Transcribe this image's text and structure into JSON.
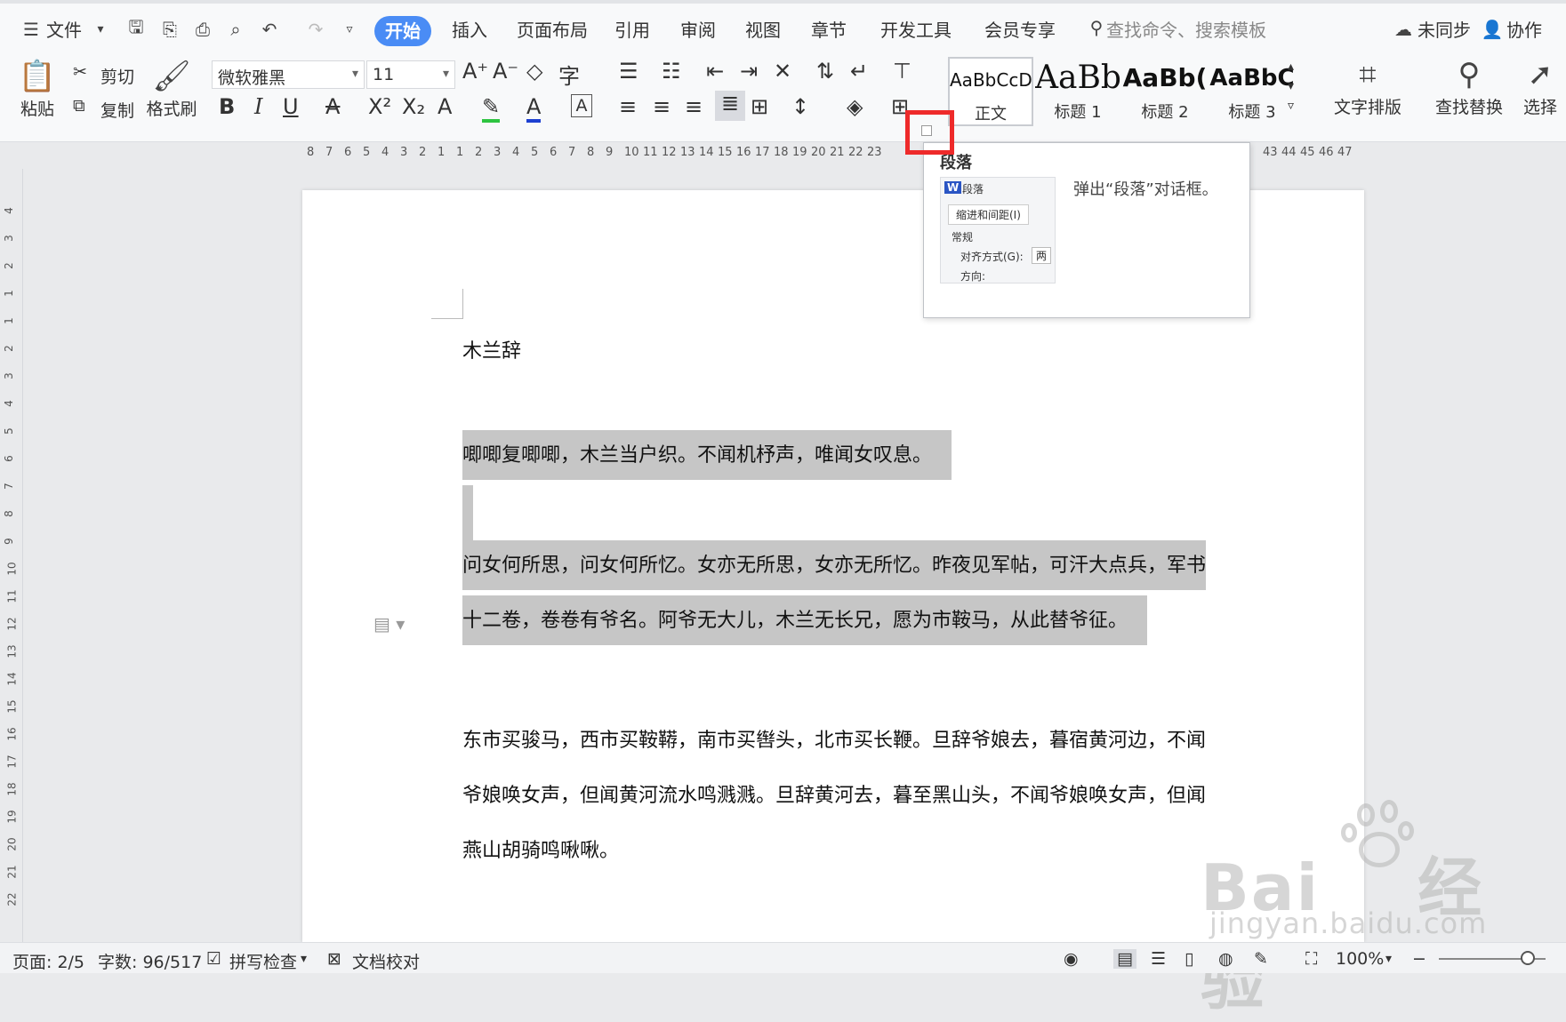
{
  "menubar": {
    "file": "文件",
    "tabs": [
      "开始",
      "插入",
      "页面布局",
      "引用",
      "审阅",
      "视图",
      "章节",
      "开发工具",
      "会员专享"
    ],
    "active_tab": "开始",
    "search_placeholder": "查找命令、搜索模板",
    "sync": "未同步",
    "collab": "协作"
  },
  "ribbon": {
    "paste": "粘贴",
    "cut": "剪切",
    "copy": "复制",
    "format_painter": "格式刷",
    "font_name": "微软雅黑",
    "font_size": "11",
    "styles": [
      {
        "sample": "AaBbCcDd",
        "label": "正文"
      },
      {
        "sample": "AaBb",
        "label": "标题 1"
      },
      {
        "sample": "AaBb(",
        "label": "标题 2"
      },
      {
        "sample": "AaBbC",
        "label": "标题 3"
      }
    ],
    "text_layout": "文字排版",
    "find_replace": "查找替换",
    "select": "选择"
  },
  "ruler": {
    "numbers": [
      "8",
      "7",
      "6",
      "5",
      "4",
      "3",
      "2",
      "1",
      "1",
      "2",
      "3",
      "4",
      "5",
      "6",
      "7",
      "8",
      "9",
      "10",
      "11",
      "12",
      "13",
      "14",
      "15",
      "16",
      "17",
      "18",
      "19",
      "20",
      "21",
      "22",
      "23"
    ],
    "right_numbers": [
      "43",
      "44",
      "45",
      "46",
      "47"
    ]
  },
  "vruler": [
    "4",
    "3",
    "2",
    "1",
    "1",
    "2",
    "3",
    "4",
    "5",
    "6",
    "7",
    "8",
    "9",
    "10",
    "11",
    "12",
    "13",
    "14",
    "15",
    "16",
    "17",
    "18",
    "19",
    "20",
    "21",
    "22"
  ],
  "tooltip": {
    "title": "段落",
    "description": "弹出“段落”对话框。",
    "preview_title": "段落",
    "preview_tab": "缩进和间距(I)",
    "preview_section": "常规",
    "preview_align_label": "对齐方式(G):",
    "preview_align_value": "两",
    "preview_direction": "方向:"
  },
  "document": {
    "title": "木兰辞",
    "p1": "唧唧复唧唧，木兰当户织。不闻机杼声，唯闻女叹息。",
    "p2_line1": "问女何所思，问女何所忆。女亦无所思，女亦无所忆。昨夜见军帖，可汗大点兵，军书",
    "p2_line2": "十二卷，卷卷有爷名。阿爷无大儿，木兰无长兄，愿为市鞍马，从此替爷征。",
    "p3_line1": "东市买骏马，西市买鞍鞯，南市买辔头，北市买长鞭。旦辞爷娘去，暮宿黄河边，不闻",
    "p3_line2": "爷娘唤女声，但闻黄河流水鸣溅溅。旦辞黄河去，暮至黑山头，不闻爷娘唤女声，但闻",
    "p3_line3": "燕山胡骑鸣啾啾。"
  },
  "statusbar": {
    "page": "页面: 2/5",
    "words": "字数: 96/517",
    "spell": "拼写检查",
    "proof": "文档校对",
    "zoom": "100%"
  },
  "watermark": {
    "brand": "Bai",
    "brand_cn": "经验",
    "url": "jingyan.baidu.com"
  }
}
